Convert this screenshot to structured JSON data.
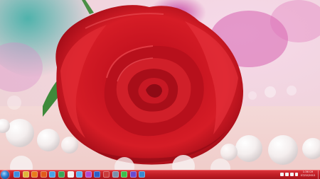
{
  "taskbar": {
    "clock": {
      "time": "1:36 CH",
      "date": "07/02/2012"
    },
    "accent_color": "#c31f26",
    "pinned": [
      {
        "name": "start-orb",
        "color": "#2f7fd0"
      },
      {
        "name": "internet-explorer-icon",
        "color": "#3b8de0"
      },
      {
        "name": "windows-explorer-icon",
        "color": "#e0b43a"
      },
      {
        "name": "media-player-icon",
        "color": "#e87b1c"
      },
      {
        "name": "firefox-icon",
        "color": "#e05a1a"
      },
      {
        "name": "app-icon",
        "color": "#4aa3e6"
      },
      {
        "name": "chrome-icon",
        "color": "#3aa657"
      },
      {
        "name": "document-icon",
        "color": "#f0f0f0"
      },
      {
        "name": "paint-icon",
        "color": "#5bb0f0"
      },
      {
        "name": "app-icon",
        "color": "#b04ad0"
      },
      {
        "name": "app-icon",
        "color": "#2b5fc8"
      },
      {
        "name": "app-icon",
        "color": "#c83a3a"
      },
      {
        "name": "calculator-icon",
        "color": "#7a8fa8"
      },
      {
        "name": "media-icon",
        "color": "#3cc04a"
      },
      {
        "name": "app-icon",
        "color": "#6a4ad0"
      },
      {
        "name": "network-icon",
        "color": "#3a8ad0"
      }
    ]
  }
}
